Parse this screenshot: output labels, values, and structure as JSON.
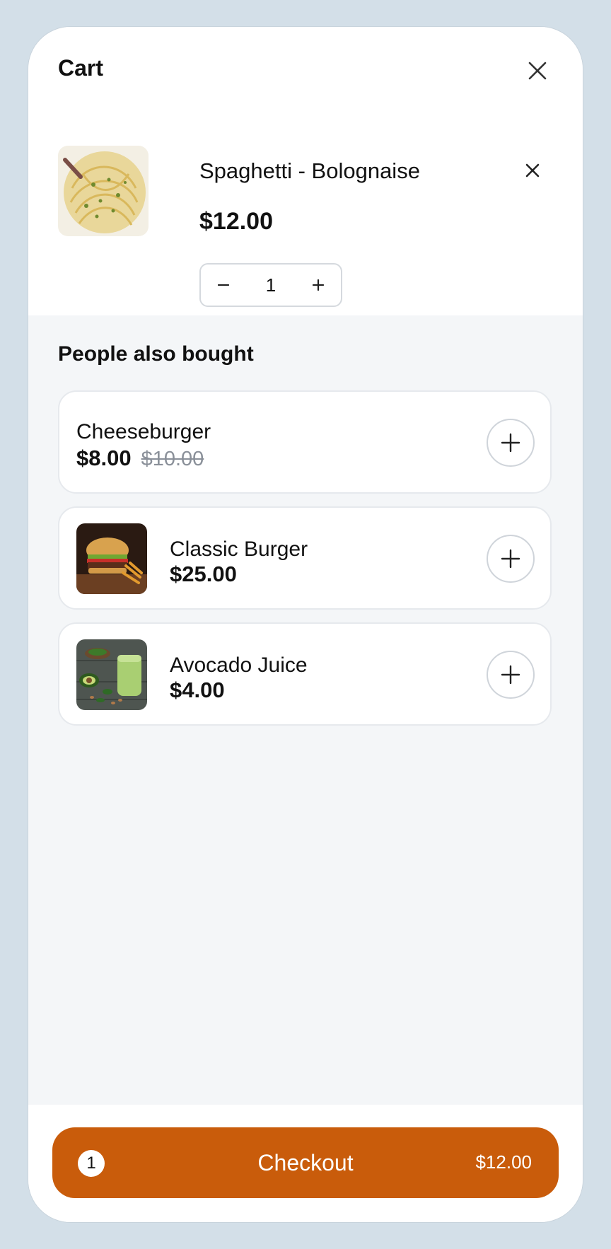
{
  "header": {
    "title": "Cart"
  },
  "cart": {
    "items": [
      {
        "name": "Spaghetti - Bolognaise",
        "price": "$12.00",
        "quantity": "1",
        "image": "spaghetti-photo"
      }
    ]
  },
  "recommendations": {
    "title": "People also bought",
    "items": [
      {
        "name": "Cheeseburger",
        "price": "$8.00",
        "old_price": "$10.00"
      },
      {
        "name": "Classic Burger",
        "price": "$25.00",
        "image": "burger-photo"
      },
      {
        "name": "Avocado Juice",
        "price": "$4.00",
        "image": "avocado-juice-photo"
      }
    ]
  },
  "checkout": {
    "count": "1",
    "label": "Checkout",
    "total": "$12.00"
  },
  "colors": {
    "accent": "#c95c0b",
    "background": "#f4f6f8",
    "frame": "#d3dfe8"
  },
  "icons": {
    "close": "close-icon",
    "remove": "remove-icon",
    "minus": "minus-icon",
    "plus": "plus-icon"
  }
}
